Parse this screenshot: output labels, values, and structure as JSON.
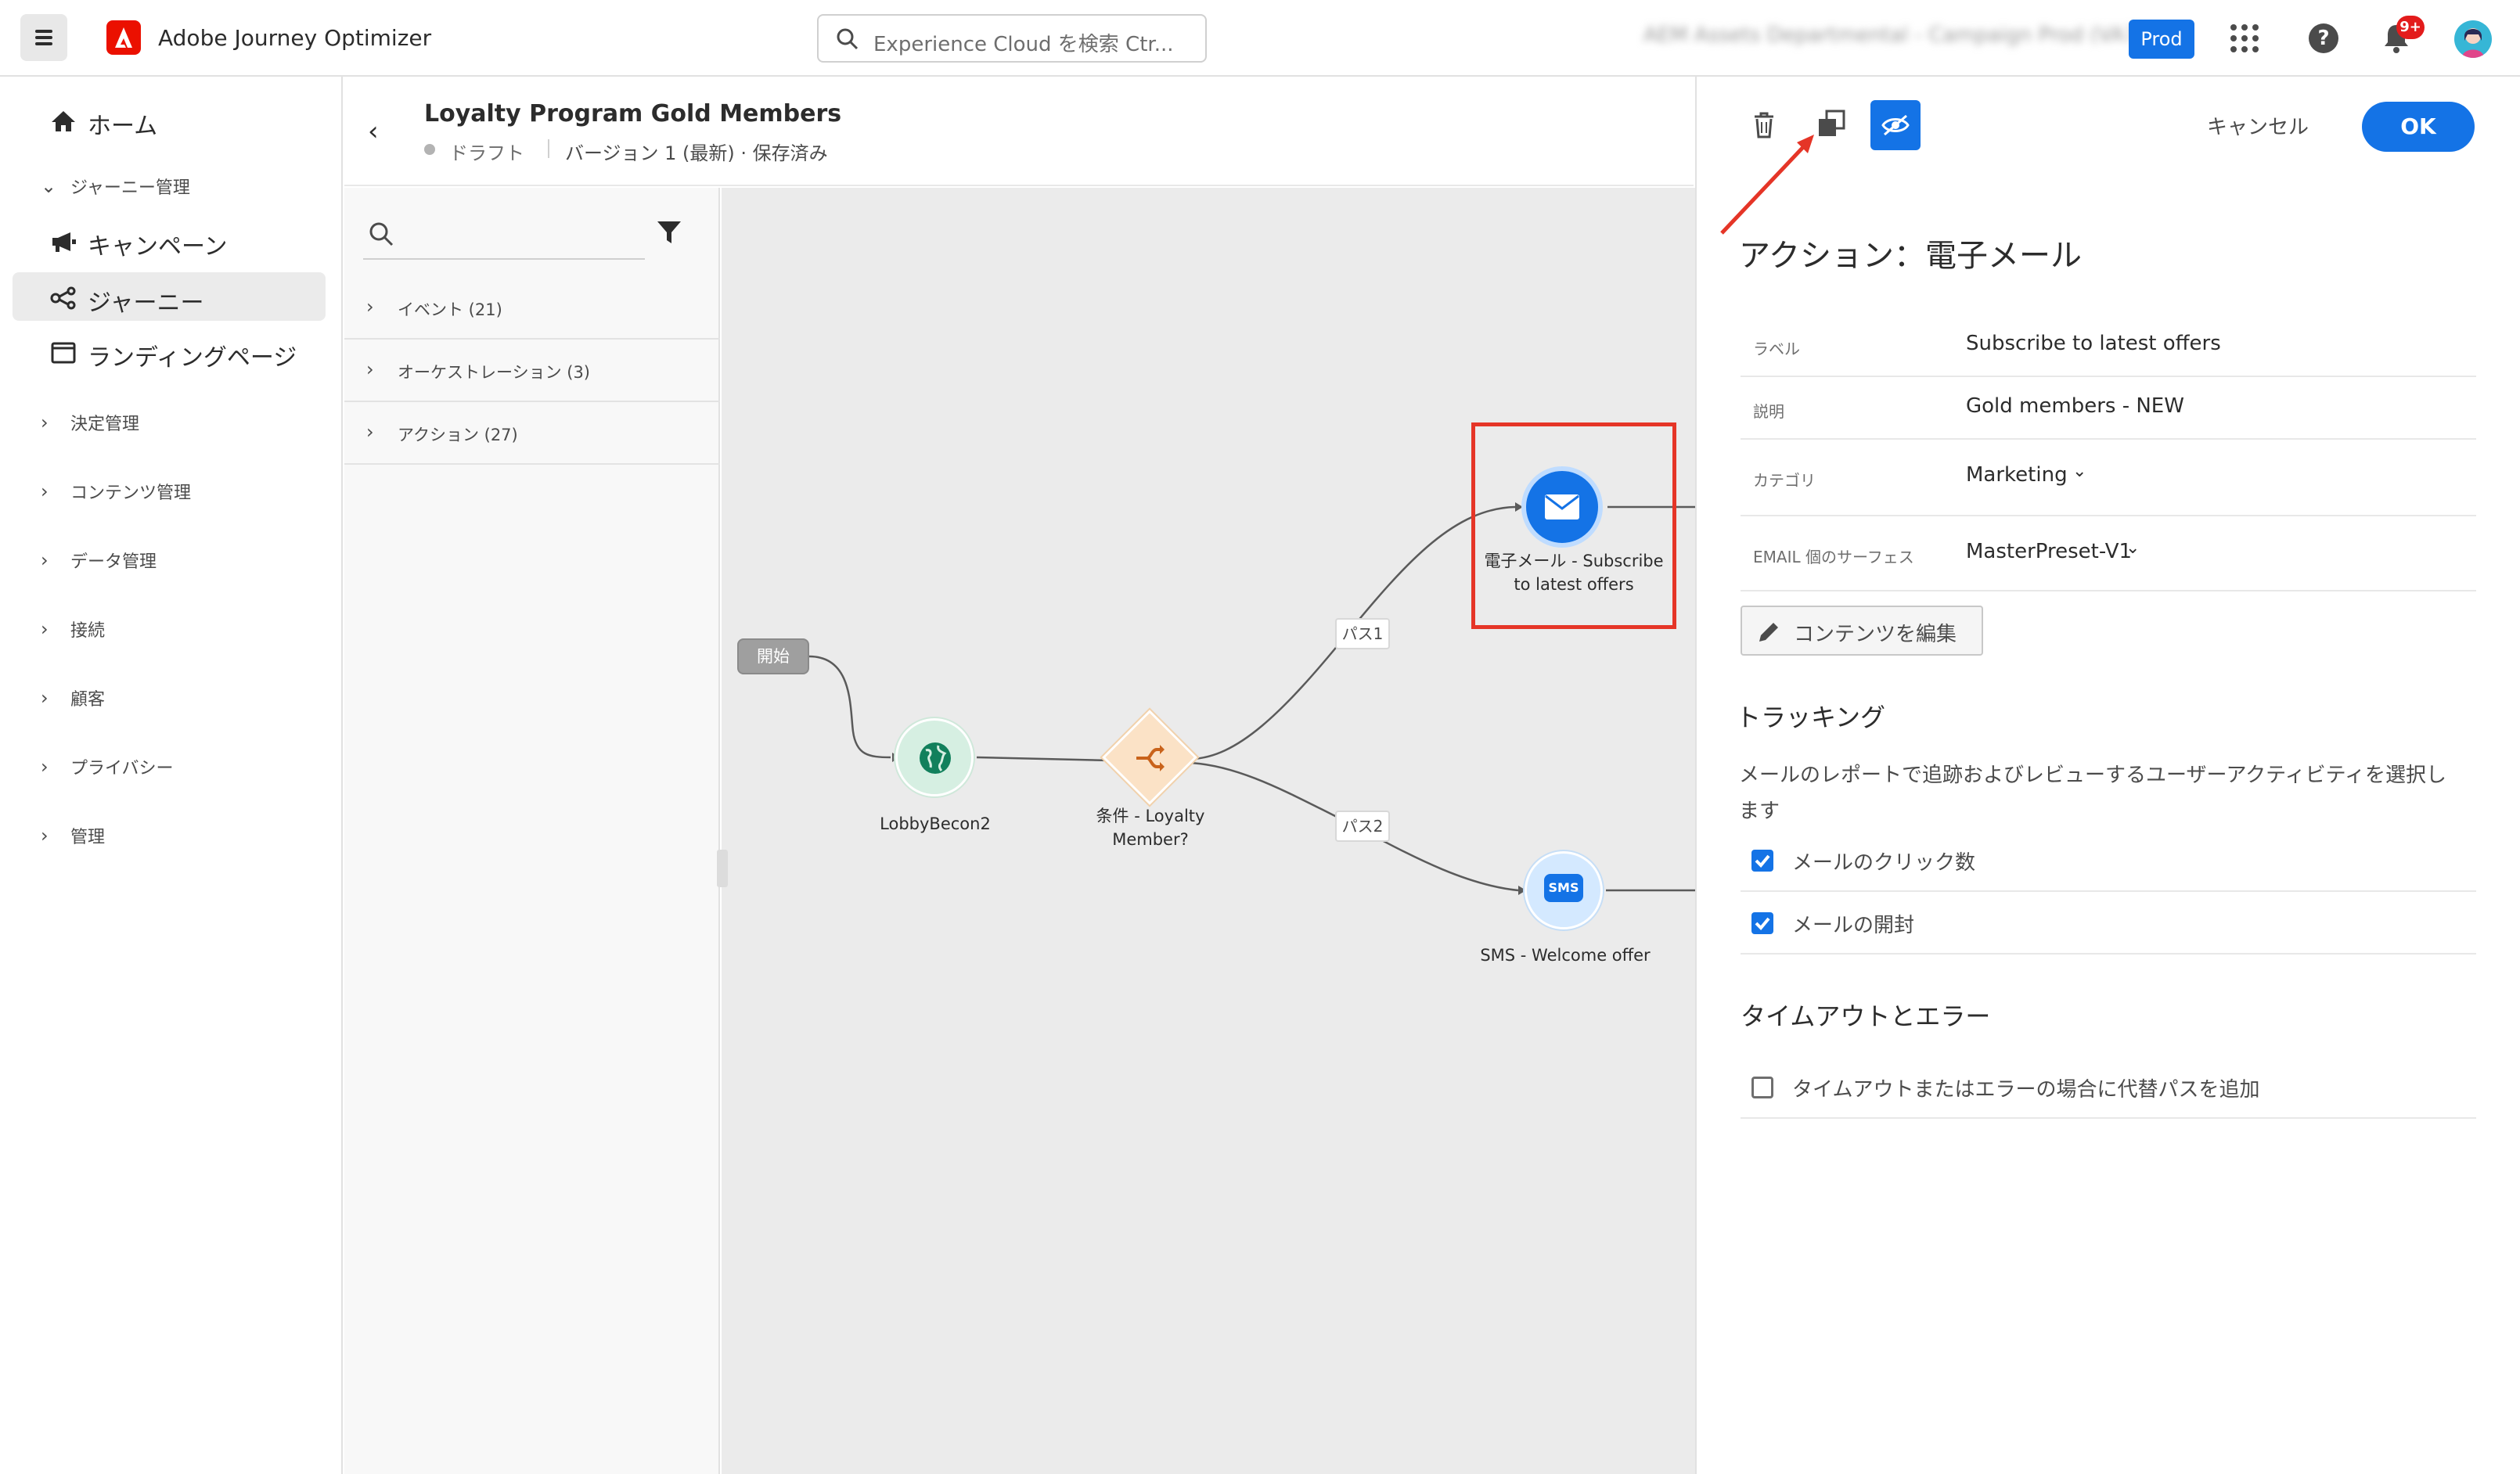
{
  "topbar": {
    "app_title": "Adobe Journey Optimizer",
    "search_placeholder": "Experience Cloud を検索 Ctr...",
    "org_name_blurred": "AEM Assets Departmental - Campaign   Prod (VA7)",
    "sandbox_badge": "Prod",
    "notification_count": "9+"
  },
  "leftnav": {
    "home": "ホーム",
    "journey_mgmt": "ジャーニー管理",
    "items": [
      {
        "label": "キャンペーン",
        "icon": "megaphone-icon"
      },
      {
        "label": "ジャーニー",
        "icon": "journey-icon",
        "selected": true
      },
      {
        "label": "ランディングページ",
        "icon": "landing-page-icon"
      }
    ],
    "groups": [
      "決定管理",
      "コンテンツ管理",
      "データ管理",
      "接続",
      "顧客",
      "プライバシー",
      "管理"
    ]
  },
  "journey": {
    "title": "Loyalty Program Gold Members",
    "status": "ドラフト",
    "version": "バージョン 1 (最新) · 保存済み"
  },
  "palette": {
    "rows": [
      "イベント (21)",
      "オーケストレーション (3)",
      "アクション (27)"
    ]
  },
  "canvas": {
    "start": "開始",
    "nodes": {
      "lobby": "LobbyBecon2",
      "condition_line1": "条件 - Loyalty",
      "condition_line2": "Member?",
      "email_line1": "電子メール - Subscribe",
      "email_line2": "to latest offers",
      "sms": "SMS - Welcome offer",
      "sms_badge": "SMS"
    },
    "paths": [
      "パス1",
      "パス2"
    ]
  },
  "panel": {
    "cancel": "キャンセル",
    "ok": "OK",
    "title": "アクション：電子メール",
    "props": [
      {
        "key": "ラベル",
        "value": "Subscribe to latest offers"
      },
      {
        "key": "説明",
        "value": "Gold members - NEW"
      },
      {
        "key": "カテゴリ",
        "value": "Marketing"
      },
      {
        "key": "EMAIL 個のサーフェス",
        "value": "MasterPreset-V1"
      }
    ],
    "edit_content": "コンテンツを編集",
    "tracking_title": "トラッキング",
    "tracking_desc": "メールのレポートで追跡およびレビューするユーザーアクティビティを選択します",
    "checks": [
      {
        "label": "メールのクリック数",
        "checked": true
      },
      {
        "label": "メールの開封",
        "checked": true
      }
    ],
    "timeout_title": "タイムアウトとエラー",
    "timeout_check": {
      "label": "タイムアウトまたはエラーの場合に代替パスを追加",
      "checked": false
    }
  },
  "colors": {
    "accent": "#1473e6",
    "highlight": "#e53527",
    "adobe_red": "#eb1000"
  }
}
